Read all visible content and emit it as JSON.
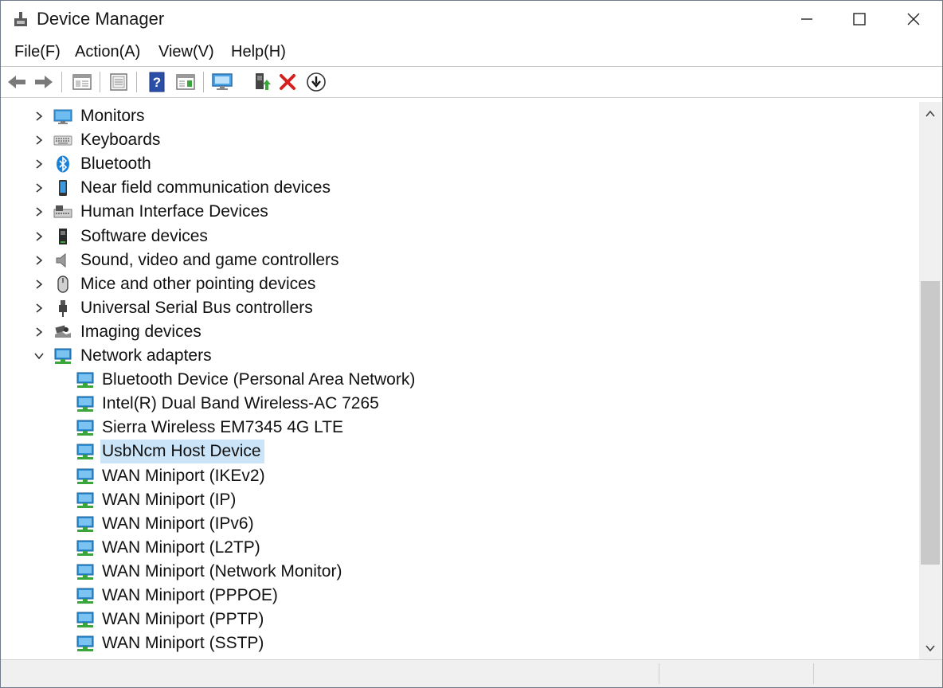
{
  "window": {
    "title": "Device Manager",
    "icon": "device-manager-icon",
    "controls": [
      "minimize-icon",
      "maximize-icon",
      "close-icon"
    ]
  },
  "menu": {
    "file": "File(F)",
    "action": "Action(A)",
    "view": "View(V)",
    "help": "Help(H)"
  },
  "toolbar": {
    "buttons": [
      "back-arrow-icon",
      "forward-arrow-icon",
      "show-hide-tree-icon",
      "properties-icon",
      "help-icon",
      "action-pane-icon",
      "scan-hardware-icon",
      "update-driver-icon",
      "uninstall-device-icon",
      "download-icon"
    ]
  },
  "tree": {
    "categories": [
      {
        "label": "Monitors",
        "icon": "monitor-icon",
        "expanded": false
      },
      {
        "label": "Keyboards",
        "icon": "keyboard-icon",
        "expanded": false
      },
      {
        "label": "Bluetooth",
        "icon": "bluetooth-icon",
        "expanded": false
      },
      {
        "label": "Near field communication devices",
        "icon": "nfc-phone-icon",
        "expanded": false
      },
      {
        "label": "Human Interface Devices",
        "icon": "hid-icon",
        "expanded": false
      },
      {
        "label": "Software devices",
        "icon": "software-device-icon",
        "expanded": false
      },
      {
        "label": "Sound, video and game controllers",
        "icon": "speaker-icon",
        "expanded": false
      },
      {
        "label": "Mice and other pointing devices",
        "icon": "mouse-icon",
        "expanded": false
      },
      {
        "label": "Universal Serial Bus controllers",
        "icon": "usb-icon",
        "expanded": false
      },
      {
        "label": "Imaging devices",
        "icon": "camera-icon",
        "expanded": false
      },
      {
        "label": "Network adapters",
        "icon": "network-adapter-icon",
        "expanded": true
      }
    ],
    "network_children": [
      {
        "label": "Bluetooth Device (Personal Area Network)",
        "selected": false
      },
      {
        "label": "Intel(R) Dual Band Wireless-AC 7265",
        "selected": false
      },
      {
        "label": "Sierra Wireless EM7345 4G LTE",
        "selected": false
      },
      {
        "label": "UsbNcm Host Device",
        "selected": true
      },
      {
        "label": "WAN Miniport (IKEv2)",
        "selected": false
      },
      {
        "label": "WAN Miniport (IP)",
        "selected": false
      },
      {
        "label": "WAN Miniport (IPv6)",
        "selected": false
      },
      {
        "label": "WAN Miniport (L2TP)",
        "selected": false
      },
      {
        "label": "WAN Miniport (Network Monitor)",
        "selected": false
      },
      {
        "label": "WAN Miniport (PPPOE)",
        "selected": false
      },
      {
        "label": "WAN Miniport (PPTP)",
        "selected": false
      },
      {
        "label": "WAN Miniport (SSTP)",
        "selected": false
      }
    ]
  },
  "colors": {
    "selection": "#cce4f7",
    "network_blue": "#2d8fd6",
    "network_green": "#3aa53a",
    "uninstall_red": "#d61f1f"
  }
}
